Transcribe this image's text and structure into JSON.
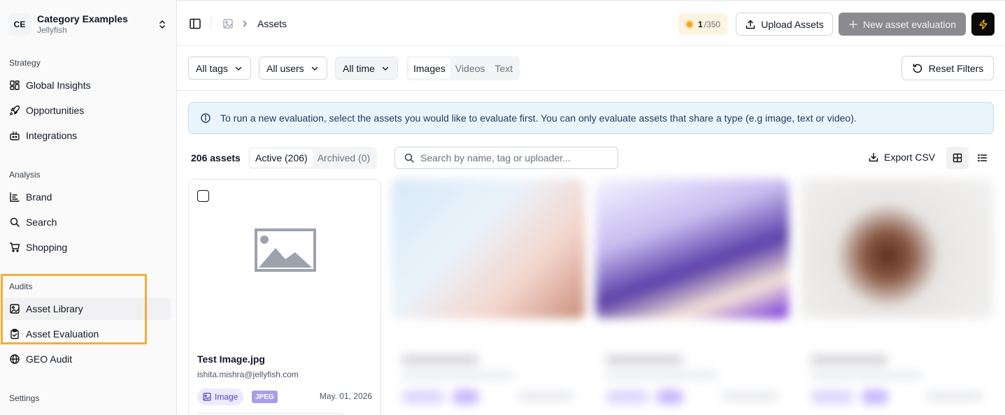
{
  "workspace": {
    "initials": "CE",
    "name": "Category Examples",
    "subtitle": "Jellyfish"
  },
  "sidebar": {
    "sections": [
      {
        "label": "Strategy",
        "items": [
          {
            "label": "Global Insights",
            "icon": "grid-icon"
          },
          {
            "label": "Opportunities",
            "icon": "rocket-icon"
          },
          {
            "label": "Integrations",
            "icon": "plug-icon"
          }
        ]
      },
      {
        "label": "Analysis",
        "items": [
          {
            "label": "Brand",
            "icon": "chart-icon"
          },
          {
            "label": "Search",
            "icon": "search-icon"
          },
          {
            "label": "Shopping",
            "icon": "cart-icon"
          }
        ]
      },
      {
        "label": "Audits",
        "items": [
          {
            "label": "Asset Library",
            "icon": "image-icon",
            "active": true
          },
          {
            "label": "Asset Evaluation",
            "icon": "clipboard-check-icon"
          },
          {
            "label": "GEO Audit",
            "icon": "globe-icon"
          }
        ]
      },
      {
        "label": "Settings",
        "items": []
      }
    ]
  },
  "topbar": {
    "breadcrumb": "Assets",
    "credits": {
      "used": "1",
      "total": "/350"
    },
    "upload_label": "Upload Assets",
    "new_eval_label": "New asset evaluation"
  },
  "filters": {
    "tags": "All tags",
    "users": "All users",
    "time": "All time",
    "types": [
      "Images",
      "Videos",
      "Text"
    ],
    "active_type": "Images",
    "reset_label": "Reset Filters"
  },
  "banner": {
    "text": "To run a new evaluation, select the assets you would like to evaluate first. You can only evaluate assets that share a type (e.g image, text or video)."
  },
  "list": {
    "count_label": "206 assets",
    "tabs": [
      "Active (206)",
      "Archived (0)"
    ],
    "search_placeholder": "Search by name, tag or uploader...",
    "export_label": "Export CSV"
  },
  "cards": [
    {
      "title": "Test Image.jpg",
      "uploader": "ishita.mishra@jellyfish.com",
      "type_chip": "Image",
      "format_chip": "JPEG",
      "date": "May. 01, 2026"
    }
  ],
  "colors": {
    "highlight": "#f6ad37",
    "chip_purple": "#ede9fe",
    "banner_bg": "#eaf4fb"
  }
}
